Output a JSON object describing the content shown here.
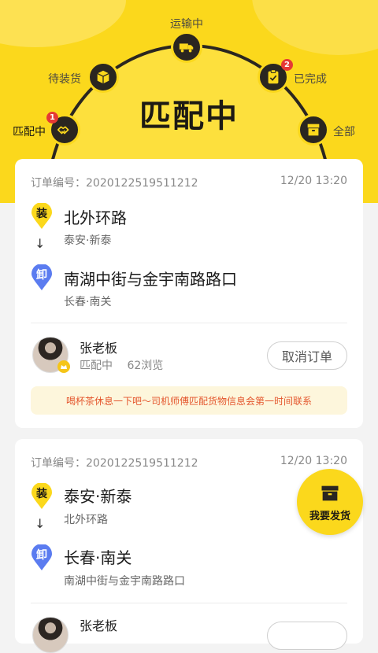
{
  "colors": {
    "brand_yellow": "#fbd81c",
    "dark": "#2a2620",
    "badge_red": "#e53935",
    "notice_text": "#e4572e",
    "pin_blue": "#5b7cf0"
  },
  "status_tabs": {
    "title": "匹配中",
    "stages": [
      {
        "label": "匹配中",
        "icon": "handshake-icon",
        "badge": "1",
        "active": true
      },
      {
        "label": "待装货",
        "icon": "box-icon",
        "badge": null,
        "active": false
      },
      {
        "label": "运输中",
        "icon": "truck-icon",
        "badge": null,
        "active": false
      },
      {
        "label": "已完成",
        "icon": "clipboard-check-icon",
        "badge": "2",
        "active": false
      },
      {
        "label": "全部",
        "icon": "archive-icon",
        "badge": null,
        "active": false
      }
    ]
  },
  "orders": [
    {
      "order_no": "订单编号：2020122519511212",
      "time": "12/20 13:20",
      "load": {
        "tag": "装",
        "main": "北外环路",
        "sub": "泰安·新泰"
      },
      "unload": {
        "tag": "卸",
        "main": "南湖中街与金宇南路路口",
        "sub": "长春·南关"
      },
      "arrow": "↓",
      "user": {
        "name": "张老板",
        "status": "匹配中",
        "views": "62浏览"
      },
      "cancel_label": "取消订单",
      "notice": "喝杯茶休息一下吧～司机师傅匹配货物信息会第一时间联系"
    },
    {
      "order_no": "订单编号：2020122519511212",
      "time": "12/20 13:20",
      "load": {
        "tag": "装",
        "main": "泰安·新泰",
        "sub": "北外环路"
      },
      "unload": {
        "tag": "卸",
        "main": "长春·南关",
        "sub": "南湖中街与金宇南路路口"
      },
      "arrow": "↓",
      "user": {
        "name": "张老板"
      }
    }
  ],
  "fab": {
    "label": "我要发货",
    "icon": "cargo-box-icon"
  }
}
